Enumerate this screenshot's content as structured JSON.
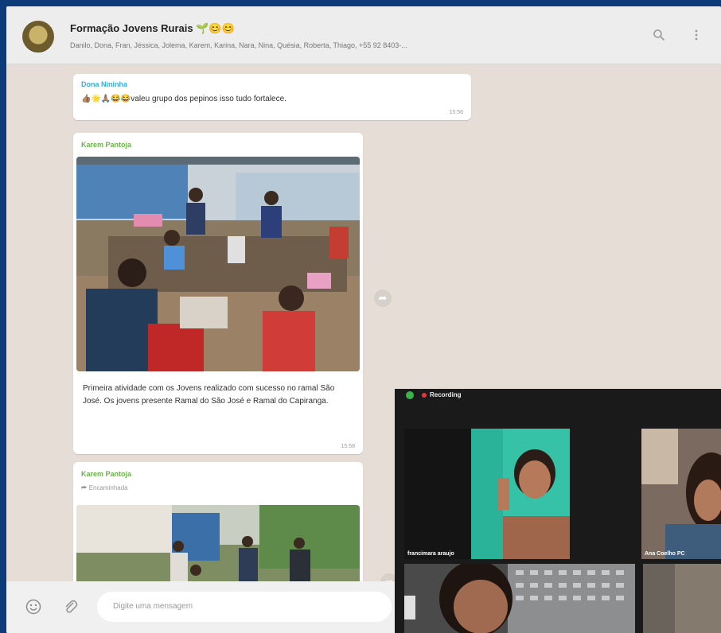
{
  "chat": {
    "group_name": "Formação Jovens Rurais",
    "group_emojis": "🌱😊😊",
    "members": "Danilo, Dona, Fran, Jéssica, Jolema, Karem, Karina, Nara, Nina, Quésia, Roberta, Thiago, +55 92 8403-..."
  },
  "header_icons": {
    "search": "search-icon",
    "menu": "menu-icon"
  },
  "messages": [
    {
      "sender": "Dona Nininha",
      "sender_color": "#35aee0",
      "emojis": "👍🏽🌟🙏🏽😂😂",
      "text": "valeu grupo dos pepinos isso tudo fortalece.",
      "time": "15:56"
    },
    {
      "sender": "Karem Pantoja",
      "sender_color": "#6bb54a",
      "caption": "Primeira atividade com os Jovens realizado com sucesso no ramal São José. Os jovens presente Ramal do São José e Ramal do Capiranga.",
      "time": "15:58"
    },
    {
      "sender": "Karem Pantoja",
      "sender_color": "#6bb54a",
      "forwarded": "Encaminhada"
    }
  ],
  "composer": {
    "placeholder": "Digite uma mensagem"
  },
  "video_call": {
    "status": "Recording",
    "participants": [
      {
        "name": "francimara araujo"
      },
      {
        "name": "Ana Coelho PC"
      },
      {
        "name": ""
      },
      {
        "name": ""
      }
    ]
  }
}
